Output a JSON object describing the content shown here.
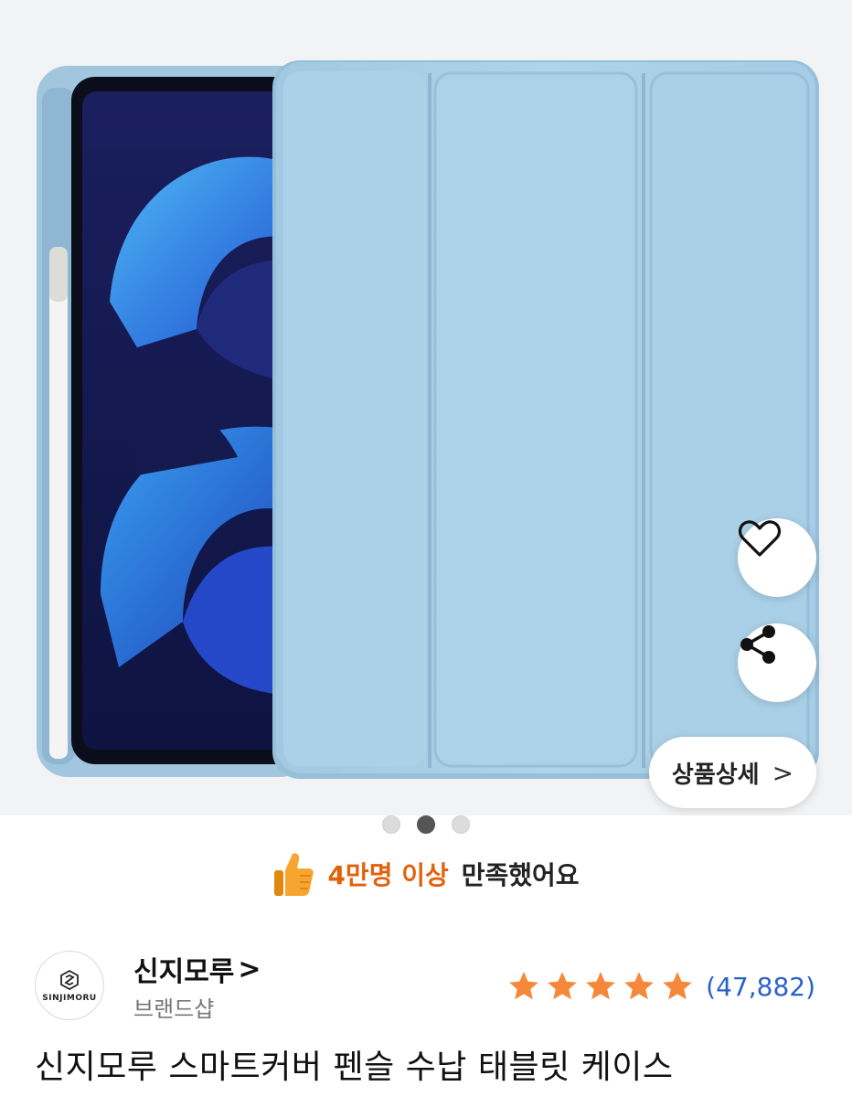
{
  "gallery": {
    "current_index": 2,
    "total": 3
  },
  "actions": {
    "detail_label": "상품상세",
    "detail_chevron": ">"
  },
  "satisfaction": {
    "highlight": "4만명 이상",
    "rest": "만족했어요"
  },
  "brand": {
    "name": "신지모루",
    "chevron": ">",
    "subtitle": "브랜드샵",
    "logo_text": "SINJIMORU"
  },
  "rating": {
    "stars": 5,
    "count": "(47,882)",
    "star_color": "#f5883a"
  },
  "product": {
    "title": "신지모루 스마트커버 펜슬 수납 태블릿 케이스"
  },
  "colors": {
    "accent_orange": "#e0620c",
    "link_blue": "#2b62c9",
    "case_blue": "#a9cfe6"
  }
}
